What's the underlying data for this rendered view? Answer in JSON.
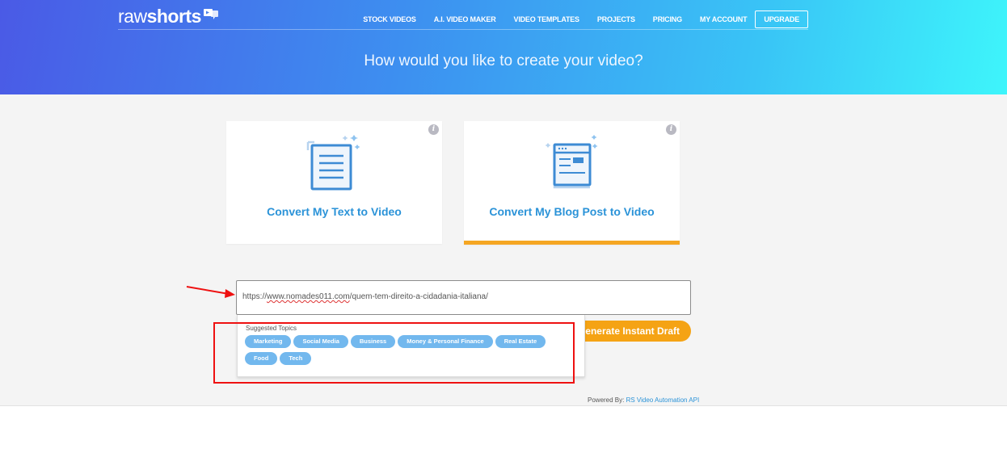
{
  "brand": {
    "logo_raw": "raw",
    "logo_shorts": "shorts"
  },
  "nav": {
    "items": [
      {
        "label": "STOCK VIDEOS"
      },
      {
        "label": "A.I. VIDEO MAKER"
      },
      {
        "label": "VIDEO TEMPLATES"
      },
      {
        "label": "PROJECTS"
      },
      {
        "label": "PRICING"
      },
      {
        "label": "MY ACCOUNT"
      }
    ],
    "upgrade_label": "UPGRADE"
  },
  "hero": {
    "title": "How would you like to create your video?"
  },
  "cards": [
    {
      "label": "Convert My Text to Video",
      "info": "i",
      "selected": false
    },
    {
      "label": "Convert My Blog Post to Video",
      "info": "i",
      "selected": true
    }
  ],
  "url_input": {
    "prefix": "https://",
    "domain": "www.nomades011.com",
    "path": "/quem-tem-direito-a-cidadania-italiana/"
  },
  "generate_button": {
    "label": "Generate Instant Draft"
  },
  "suggestions": {
    "title": "Suggested Topics",
    "topics": [
      "Marketing",
      "Social Media",
      "Business",
      "Money & Personal Finance",
      "Real Estate",
      "Food",
      "Tech"
    ]
  },
  "footer": {
    "powered_label": "Powered By:",
    "powered_link": "RS Video Automation API"
  },
  "colors": {
    "accent_blue": "#2b93d8",
    "accent_orange": "#f5a623",
    "chip_blue": "#72b8ee",
    "annotation_red": "#ee1111"
  }
}
